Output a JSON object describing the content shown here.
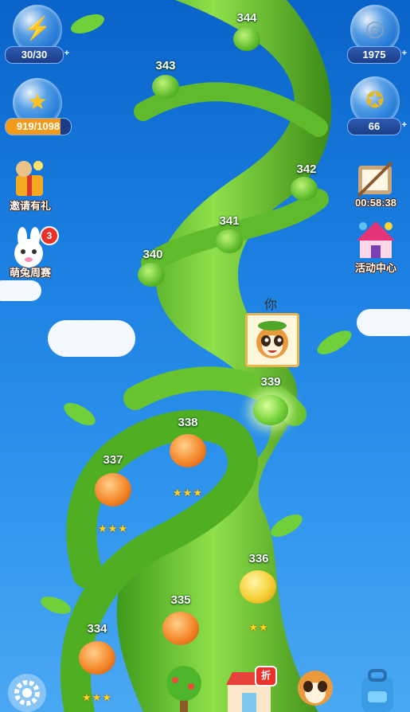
{
  "hud": {
    "energy": {
      "icon": "lightning-icon",
      "value": "30/30",
      "plus": "+"
    },
    "stars": {
      "icon": "star-icon",
      "value": "919/1098"
    },
    "gems": {
      "icon": "gem-icon",
      "value": "1975",
      "plus": "+"
    },
    "coins": {
      "icon": "coin-icon",
      "value": "66",
      "plus": "+"
    }
  },
  "side_left": [
    {
      "icon": "gift-bear-icon",
      "label": "邀请有礼"
    },
    {
      "icon": "bunny-icon",
      "label": "萌兔周赛",
      "badge": "3"
    }
  ],
  "side_right": [
    {
      "icon": "calendar-board-icon",
      "label": "00:58:38"
    },
    {
      "icon": "carnival-tent-icon",
      "label": "活动中心"
    }
  ],
  "player": {
    "you_label": "你",
    "avatar_icon": "raccoon-avatar-icon"
  },
  "levels": [
    {
      "number": "344",
      "kind": "green"
    },
    {
      "number": "343",
      "kind": "green"
    },
    {
      "number": "342",
      "kind": "green"
    },
    {
      "number": "341",
      "kind": "green"
    },
    {
      "number": "340",
      "kind": "green"
    },
    {
      "number": "339",
      "kind": "current"
    },
    {
      "number": "338",
      "kind": "orange",
      "stars": 3
    },
    {
      "number": "337",
      "kind": "orange",
      "stars": 3
    },
    {
      "number": "336",
      "kind": "yellow",
      "stars": 2
    },
    {
      "number": "335",
      "kind": "orange"
    },
    {
      "number": "334",
      "kind": "orange",
      "stars": 3
    }
  ],
  "bottom_bar": [
    {
      "icon": "settings-gear-icon"
    },
    {
      "icon": "tree-icon"
    },
    {
      "icon": "shop-icon",
      "badge": "折"
    },
    {
      "icon": "raccoon-friend-icon"
    },
    {
      "icon": "backpack-icon"
    }
  ],
  "colors": {
    "sky_top": "#0a63c9",
    "sky_bottom": "#4aa8f3",
    "vine": "#5cb82a"
  }
}
